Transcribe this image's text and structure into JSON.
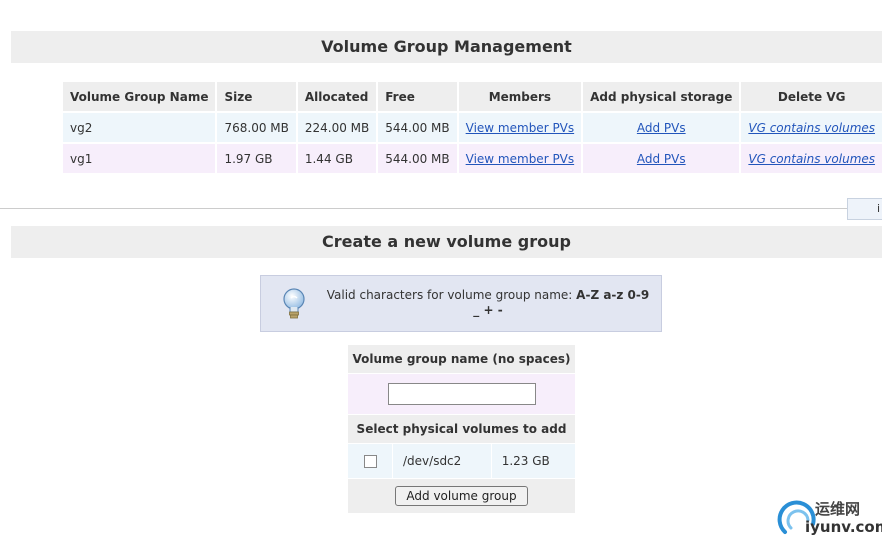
{
  "vg_section": {
    "title": "Volume Group Management",
    "headers": [
      "Volume Group Name",
      "Size",
      "Allocated",
      "Free",
      "Members",
      "Add physical storage",
      "Delete VG"
    ],
    "rows": [
      {
        "name": "vg2",
        "size": "768.00 MB",
        "allocated": "224.00 MB",
        "free": "544.00 MB",
        "members_link": "View member PVs",
        "add_link": "Add PVs",
        "delete_link": "VG contains volumes"
      },
      {
        "name": "vg1",
        "size": "1.97 GB",
        "allocated": "1.44 GB",
        "free": "544.00 MB",
        "members_link": "View member PVs",
        "add_link": "Add PVs",
        "delete_link": "VG contains volumes"
      }
    ]
  },
  "side_tab": {
    "label": "i"
  },
  "create_section": {
    "title": "Create a new volume group",
    "hint_prefix": "Valid characters for volume group name:",
    "hint_chars": "A-Z a-z 0-9 _ + -",
    "name_header": "Volume group name (no spaces)",
    "name_value": "",
    "pv_header": "Select physical volumes to add",
    "pvs": [
      {
        "device": "/dev/sdc2",
        "size": "1.23 GB"
      }
    ],
    "submit_label": "Add volume group"
  },
  "watermark": {
    "cn": "运维网",
    "en": "iyunv.com"
  },
  "colors": {
    "link": "#2255bb",
    "header_bg": "#eeeeee",
    "row_blue": "#eef6fb",
    "row_lavender": "#f7eefb"
  }
}
